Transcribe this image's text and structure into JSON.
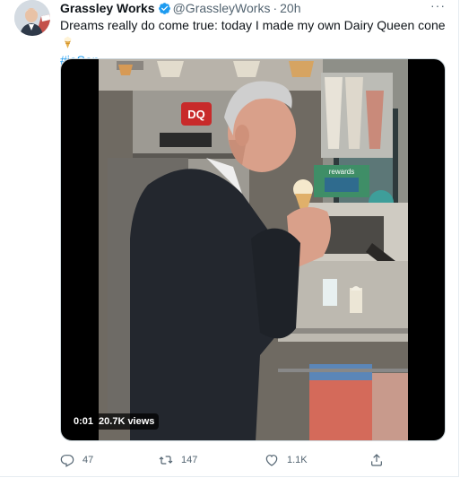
{
  "tweet": {
    "display_name": "Grassley Works",
    "handle": "@GrassleyWorks",
    "separator": "·",
    "timestamp": "20h",
    "text": "Dreams really do come true: today I made my own Dairy Queen cone",
    "hashtag": "#iaSen",
    "more_label": "···"
  },
  "video": {
    "time": "0:01",
    "views": "20.7K views",
    "sign_text": "DQ",
    "rewards_text": "rewards"
  },
  "actions": {
    "replies": "47",
    "retweets": "147",
    "likes": "1.1K"
  },
  "colors": {
    "link": "#1d9bf0",
    "verified": "#1d9bf0",
    "secondary_text": "#536471"
  }
}
